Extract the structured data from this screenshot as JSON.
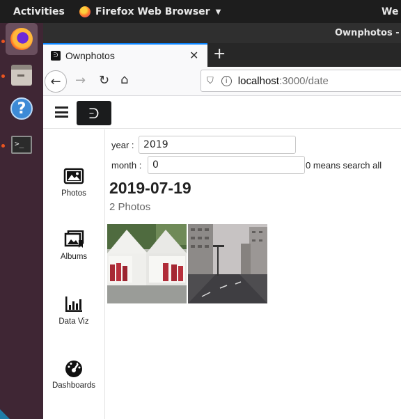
{
  "topbar": {
    "activities": "Activities",
    "app_name": "Firefox Web Browser",
    "clock_partial": "We"
  },
  "window": {
    "title": "Ownphotos -"
  },
  "tabs": [
    {
      "title": "Ownphotos",
      "active": true
    }
  ],
  "navbar": {
    "url_host": "localhost",
    "url_rest": ":3000/date"
  },
  "sidebar": {
    "items": [
      {
        "label": "Photos",
        "icon": "photos-icon"
      },
      {
        "label": "Albums",
        "icon": "albums-icon"
      },
      {
        "label": "Data Viz",
        "icon": "bar-chart-icon"
      },
      {
        "label": "Dashboards",
        "icon": "dashboard-icon"
      }
    ]
  },
  "filters": {
    "year_label": "year :",
    "year_value": "2019",
    "month_label": "month :",
    "month_value": "0",
    "month_hint": "0 means search all"
  },
  "results": {
    "date": "2019-07-19",
    "count_label": "2 Photos",
    "photos": [
      {
        "subject": "white tents with posters"
      },
      {
        "subject": "empty city street with apartment buildings"
      }
    ]
  },
  "colors": {
    "dock_bg": "#3f2634",
    "accent_orange": "#e95420",
    "tab_highlight": "#0a84ff"
  }
}
